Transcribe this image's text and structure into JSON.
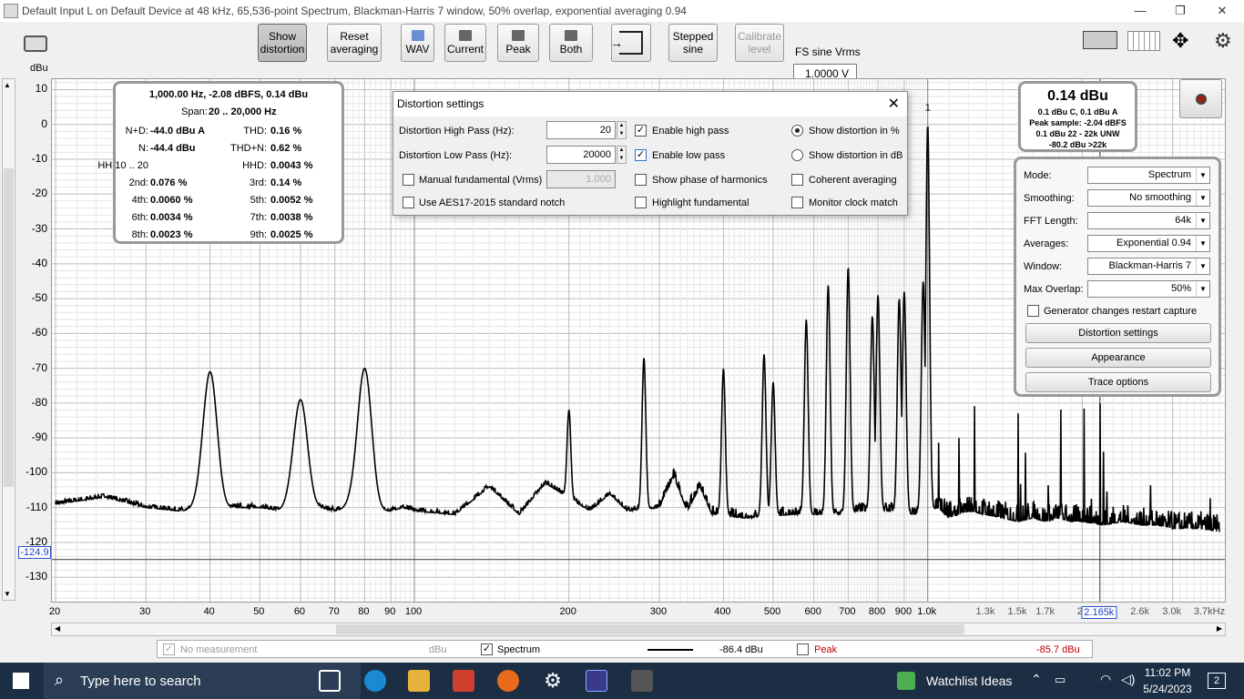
{
  "window": {
    "title": "Default Input L on Default Device at 48 kHz, 65,536-point Spectrum, Blackman-Harris 7 window, 50% overlap, exponential averaging 0.94"
  },
  "toolbar": {
    "buttons": [
      {
        "label1": "Show",
        "label2": "distortion"
      },
      {
        "label1": "Reset",
        "label2": "averaging"
      },
      {
        "label1": "",
        "label2": "WAV"
      },
      {
        "label1": "",
        "label2": "Current"
      },
      {
        "label1": "",
        "label2": "Peak"
      },
      {
        "label1": "",
        "label2": "Both"
      },
      {
        "label1": "Stepped",
        "label2": "sine"
      },
      {
        "label1": "Calibrate",
        "label2": "level"
      }
    ],
    "fs_label": "FS sine Vrms",
    "fs_value": "1.0000 V"
  },
  "axis": {
    "y_unit": "dBu",
    "y_ticks": [
      "10",
      "0",
      "-10",
      "-20",
      "-30",
      "-40",
      "-50",
      "-60",
      "-70",
      "-80",
      "-90",
      "-100",
      "-110",
      "-120",
      "-130"
    ],
    "x_ticks": [
      "20",
      "30",
      "40",
      "50",
      "60",
      "70",
      "80",
      "90",
      "100",
      "200",
      "300",
      "400",
      "500",
      "600",
      "700",
      "800",
      "900",
      "1.0k",
      "1.3k",
      "1.5k",
      "1.7k",
      "2.",
      "2.165k",
      "2.6k",
      "3.0k",
      "3.7kHz"
    ],
    "cursor_y": "-124.9",
    "cursor_x": "2.165k"
  },
  "chart_data": {
    "type": "line",
    "xlabel": "",
    "ylabel": "dBu",
    "xscale": "log",
    "xlim": [
      20,
      3700
    ],
    "ylim": [
      -137,
      13
    ],
    "grid": true,
    "series": [
      {
        "name": "Spectrum",
        "color": "#000000",
        "x": [
          20,
          25,
          30,
          35,
          40,
          45,
          50,
          55,
          60,
          65,
          70,
          75,
          80,
          85,
          90,
          95,
          100,
          120,
          140,
          160,
          180,
          200,
          220,
          240,
          260,
          280,
          300,
          320,
          340,
          360,
          380,
          400,
          440,
          480,
          500,
          540,
          580,
          600,
          640,
          680,
          700,
          740,
          780,
          800,
          840,
          880,
          900,
          940,
          980,
          1000,
          1050,
          1100,
          1200,
          1300,
          1400,
          1500,
          1600,
          1700,
          1800,
          1900,
          2000,
          2200,
          2400,
          2600,
          2800,
          3000,
          3200,
          3400,
          3700
        ],
        "values": [
          -109,
          -107,
          -110,
          -111,
          -71,
          -110,
          -110,
          -111,
          -79,
          -110,
          -111,
          -110,
          -70,
          -111,
          -111,
          -110,
          -111,
          -112,
          -104,
          -112,
          -103,
          -82,
          -111,
          -106,
          -111,
          -67,
          -110,
          -101,
          -111,
          -104,
          -112,
          -70,
          -113,
          -66,
          -74,
          -112,
          -56,
          -112,
          -46,
          -112,
          -41,
          -111,
          -55,
          -49,
          -111,
          -50,
          -48,
          -112,
          -45,
          0,
          -110,
          -113,
          -111,
          -112,
          -113,
          -114,
          -113,
          -114,
          -113,
          -114,
          -114,
          -115,
          -114,
          -115,
          -115,
          -116,
          -116,
          -116,
          -117
        ]
      }
    ],
    "title": ""
  },
  "distortion_readout": {
    "header": "1,000.00 Hz, -2.08 dBFS, 0.14 dBu",
    "span_label": "Span:",
    "span_value": "20 .. 20,000 Hz",
    "rows": [
      {
        "l1": "N+D:",
        "v1": "-44.0 dBu A",
        "l2": "THD:",
        "v2": "0.16 %"
      },
      {
        "l1": "N:",
        "v1": "-44.4 dBu",
        "l2": "THD+N:",
        "v2": "0.62 %"
      },
      {
        "l1": "HH 10 .. 20",
        "v1": "",
        "l2": "HHD:",
        "v2": "0.0043 %"
      },
      {
        "l1": "2nd:",
        "v1": "0.076 %",
        "l2": "3rd:",
        "v2": "0.14 %"
      },
      {
        "l1": "4th:",
        "v1": "0.0060 %",
        "l2": "5th:",
        "v2": "0.0052 %"
      },
      {
        "l1": "6th:",
        "v1": "0.0034 %",
        "l2": "7th:",
        "v2": "0.0038 %"
      },
      {
        "l1": "8th:",
        "v1": "0.0023 %",
        "l2": "9th:",
        "v2": "0.0025 %"
      }
    ]
  },
  "dialog": {
    "title": "Distortion settings",
    "hp_label": "Distortion High Pass (Hz):",
    "hp_value": "20",
    "lp_label": "Distortion Low Pass (Hz):",
    "lp_value": "20000",
    "manual_label": "Manual fundamental (Vrms)",
    "manual_value": "1.000",
    "aes_label": "Use AES17-2015 standard notch",
    "enable_hp": "Enable high pass",
    "enable_lp": "Enable low pass",
    "show_phase": "Show phase of harmonics",
    "highlight": "Highlight fundamental",
    "pct": "Show distortion in %",
    "db": "Show distortion in dB",
    "coherent": "Coherent averaging",
    "monitor": "Monitor clock match"
  },
  "level_meter": {
    "main": "0.14 dBu",
    "line1": "0.1 dBu C, 0.1 dBu A",
    "line2": "Peak sample: -2.04 dBFS",
    "line3": "0.1 dBu 22 - 22k UNW",
    "line4": "-80.2 dBu >22k"
  },
  "controls": {
    "mode_label": "Mode:",
    "mode": "Spectrum",
    "smoothing_label": "Smoothing:",
    "smoothing": "No  smoothing",
    "fft_label": "FFT Length:",
    "fft": "64k",
    "avg_label": "Averages:",
    "avg": "Exponential 0.94",
    "window_label": "Window:",
    "window": "Blackman-Harris 7",
    "overlap_label": "Max Overlap:",
    "overlap": "50%",
    "gen_label": "Generator changes restart capture",
    "btn_dist": "Distortion settings",
    "btn_app": "Appearance",
    "btn_trace": "Trace options"
  },
  "legend": {
    "nomeas": "No measurement",
    "nomeas_unit": "dBu",
    "spectrum": "Spectrum",
    "spectrum_val": "-86.4 dBu",
    "peak": "Peak",
    "peak_val": "-85.7 dBu",
    "peak_color": "#c00000"
  },
  "harmonic_marker": "1",
  "taskbar": {
    "search": "Type here to search",
    "watchlist": "Watchlist Ideas",
    "time": "11:02 PM",
    "date": "5/24/2023",
    "notif": "2"
  }
}
